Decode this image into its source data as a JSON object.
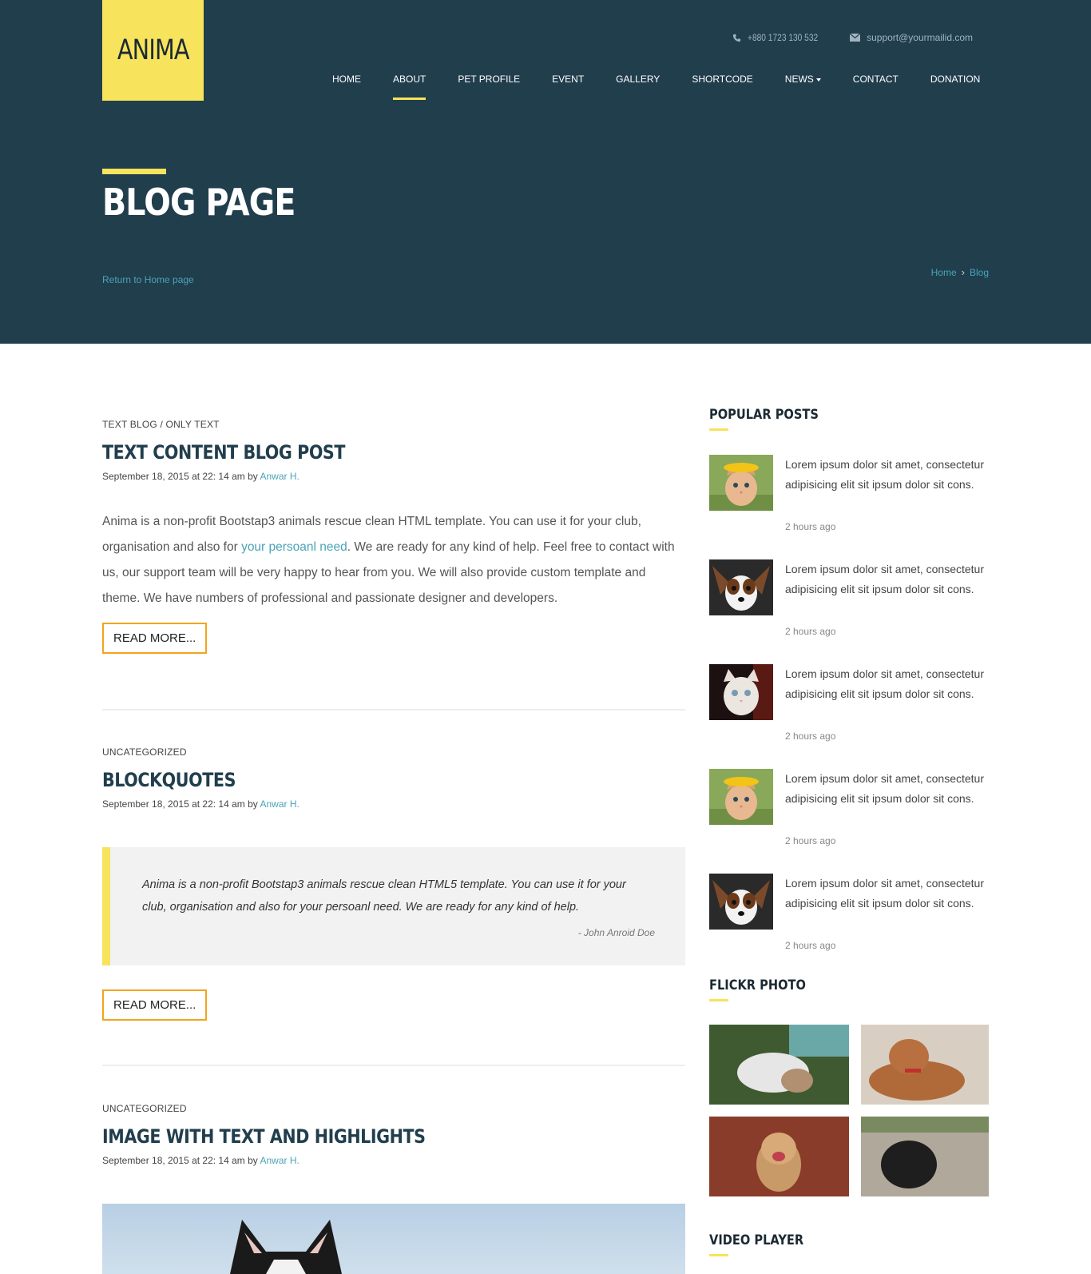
{
  "brand": {
    "logo_text": "ANIMA"
  },
  "contact": {
    "phone": "+880 1723 130 532",
    "email": "support@yourmailid.com"
  },
  "nav": {
    "items": [
      "HOME",
      "ABOUT",
      "PET PROFILE",
      "EVENT",
      "GALLERY",
      "SHORTCODE",
      "NEWS",
      "CONTACT",
      "DONATION"
    ],
    "active": "ABOUT"
  },
  "hero": {
    "title": "BLOG PAGE",
    "return_link": "Return to Home page",
    "breadcrumb": [
      "Home",
      "Blog"
    ]
  },
  "posts": [
    {
      "category": "TEXT BLOG / ONLY TEXT",
      "title": "TEXT CONTENT BLOG POST",
      "meta_date": "September 18, 2015 at 22: 14 am by",
      "meta_author": "Anwar H.",
      "body_before": "Anima is a non-profit Bootstap3 animals rescue clean HTML template. You can use it for your club, organisation and also for ",
      "body_link": "your persoanl need",
      "body_after": ". We are ready for any kind of help. Feel free to contact with us, our support team will be very happy to hear from you. We will also provide custom template and theme. We have numbers of professional and passionate designer and developers.",
      "read_more": "READ MORE..."
    },
    {
      "category": "UNCATEGORIZED",
      "title": "BLOCKQUOTES",
      "meta_date": "September 18, 2015 at 22: 14 am by",
      "meta_author": "Anwar H.",
      "quote": "Anima is a non-profit Bootstap3 animals rescue clean HTML5 template. You can use it for your club, organisation and also for your persoanl need. We are ready for any kind of help.",
      "quote_author": "- John Anroid Doe",
      "read_more": "READ MORE..."
    },
    {
      "category": "UNCATEGORIZED",
      "title": "IMAGE WITH TEXT AND HIGHLIGHTS",
      "meta_date": "September 18, 2015 at 22: 14 am by",
      "meta_author": "Anwar H."
    }
  ],
  "sidebar": {
    "popular_title": "POPULAR POSTS",
    "popular_posts": [
      {
        "text": "Lorem ipsum dolor sit amet, consectetur adipisicing elit sit ipsum dolor sit cons.",
        "time": "2 hours ago",
        "thumb": "kitten-flower-crown"
      },
      {
        "text": "Lorem ipsum dolor sit amet, consectetur adipisicing elit sit ipsum dolor sit cons.",
        "time": "2 hours ago",
        "thumb": "papillon-dog"
      },
      {
        "text": "Lorem ipsum dolor sit amet, consectetur adipisicing elit sit ipsum dolor sit cons.",
        "time": "2 hours ago",
        "thumb": "white-kitten"
      },
      {
        "text": "Lorem ipsum dolor sit amet, consectetur adipisicing elit sit ipsum dolor sit cons.",
        "time": "2 hours ago",
        "thumb": "kitten-flower-crown"
      },
      {
        "text": "Lorem ipsum dolor sit amet, consectetur adipisicing elit sit ipsum dolor sit cons.",
        "time": "2 hours ago",
        "thumb": "papillon-dog"
      }
    ],
    "flickr_title": "FLICKR PHOTO",
    "video_title": "VIDEO PLAYER"
  },
  "colors": {
    "header_bg": "#213e4d",
    "accent_yellow": "#f7e35c",
    "link_teal": "#4aa3b8",
    "button_border": "#f3a41e"
  }
}
